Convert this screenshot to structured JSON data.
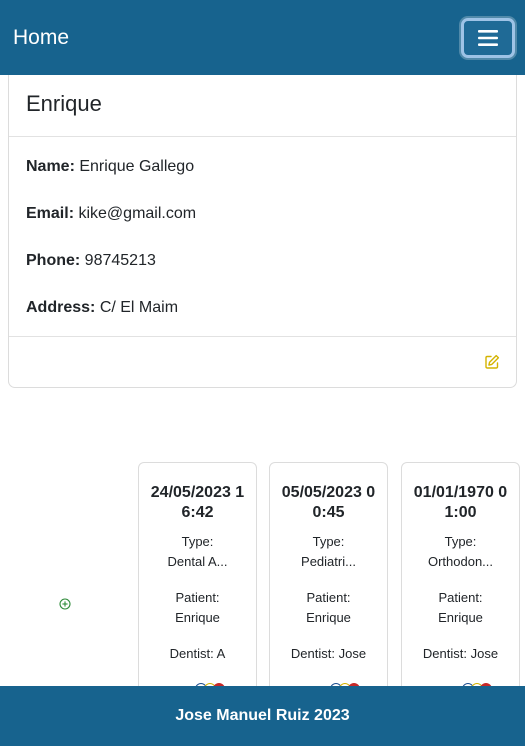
{
  "navbar": {
    "brand": "Home"
  },
  "profile": {
    "title": "Enrique",
    "fields": [
      {
        "label": "Name:",
        "value": "Enrique Gallego"
      },
      {
        "label": "Email:",
        "value": "kike@gmail.com"
      },
      {
        "label": "Phone:",
        "value": "98745213"
      },
      {
        "label": "Address:",
        "value": "C/ El Maim"
      }
    ]
  },
  "colors": {
    "primary": "#17638e",
    "edit_icon": "#d4b300",
    "add_icon": "#2e8b3a"
  },
  "icons": {
    "menu": "hamburger-icon",
    "edit": "edit-icon",
    "add": "plus-circle-icon"
  },
  "appointments": [
    {
      "date": "24/05/2023 16:42",
      "type_label": "Type:",
      "type": "Dental A...",
      "patient_label": "Patient:",
      "patient": "Enrique",
      "dentist": "Dentist: A"
    },
    {
      "date": "05/05/2023 00:45",
      "type_label": "Type:",
      "type": "Pediatri...",
      "patient_label": "Patient:",
      "patient": "Enrique",
      "dentist": "Dentist: Jose"
    },
    {
      "date": "01/01/1970 01:00",
      "type_label": "Type:",
      "type": "Orthodon...",
      "patient_label": "Patient:",
      "patient": "Enrique",
      "dentist": "Dentist: Jose"
    }
  ],
  "footer": {
    "text": "Jose Manuel Ruiz 2023"
  }
}
